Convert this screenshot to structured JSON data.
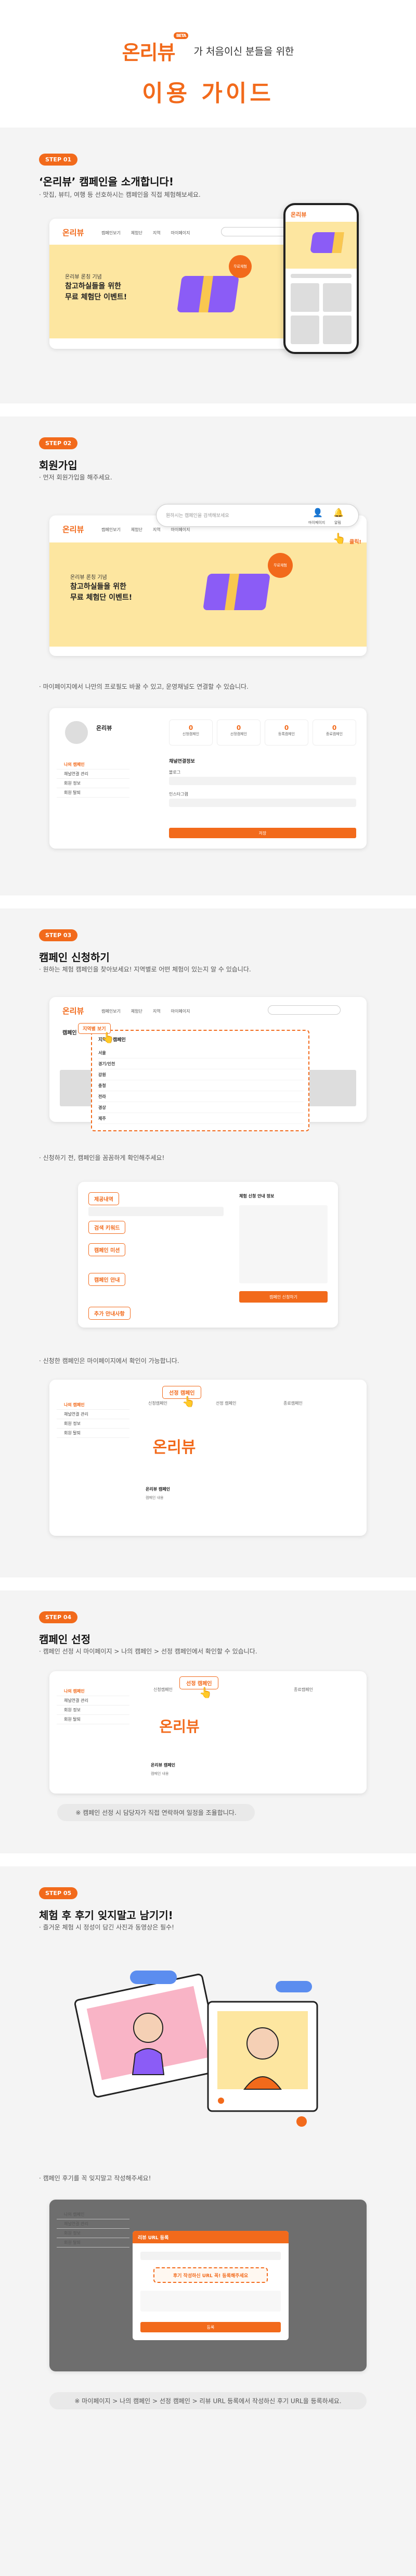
{
  "hero": {
    "logo": "온리뷰",
    "beta": "BETA",
    "subtitle": "가 처음이신 분들을 위한",
    "title": "이용 가이드"
  },
  "steps": [
    {
      "badge": "STEP 01",
      "title": "‘온리뷰’ 캠페인을 소개합니다!",
      "desc": "· 맛집, 뷰티, 여행 등 선호하시는 캠페인을 직접 체험해보세요."
    },
    {
      "badge": "STEP 02",
      "title": "회원가입",
      "desc": "· 먼저 회원가입을 해주세요.",
      "desc2": "· 마이페이지에서 나만의 프로필도 바꿀 수 있고, 운영채널도 연결할 수 있습니다."
    },
    {
      "badge": "STEP 03",
      "title": "캠페인 신청하기",
      "desc": "· 원하는 체험 캠페인을 찾아보세요! 지역별로 어떤 체험이 있는지 알 수 있습니다.",
      "desc2": "· 신청하기 전, 캠페인을 꼼꼼하게 확인해주세요!",
      "desc3": "· 신청한 캠페인은 마이페이지에서 확인이 가능합니다."
    },
    {
      "badge": "STEP 04",
      "title": "캠페인 선정",
      "desc": "· 캠페인 선정 시 마이페이지 > 나의 캠페인 > 선정 캠페인에서 확인할 수 있습니다.",
      "note": "※ 캠페인 선정 시 담당자가 직접 연락하여 일정을 조율합니다."
    },
    {
      "badge": "STEP 05",
      "title": "체험 후 후기 잊지말고 남기기!",
      "desc": "· 즐거운 체험 시 정성이 담긴 사진과 동영상은 필수!",
      "desc2": "· 캠페인 후기를 꼭 잊지말고 작성해주세요!",
      "note": "※ 마이페이지 > 나의 캠페인 > 선정 캠페인 > 리뷰 URL 등록에서 작성하신 후기 URL을 등록하세요."
    }
  ],
  "mock1": {
    "nav": [
      "캠페인보기",
      "체험단",
      "지역",
      "마이페이지"
    ],
    "banner_small": "온리뷰 론칭 기념",
    "banner_big1": "참고하실들을 위한",
    "banner_big2": "무료 체험단 이벤트!",
    "bubble": "무료체험"
  },
  "mock2": {
    "search_placeholder": "원하시는 캠페인을 검색해보세요",
    "icon_labels": [
      "마이페이지",
      "알림"
    ],
    "click_label": "클릭!"
  },
  "mypage": {
    "name": "온리뷰",
    "menu": [
      "나의 캠페인",
      "채널연결 관리",
      "회원 정보",
      "회원 탈퇴"
    ],
    "stats": [
      "신청캠페인",
      "선정캠페인",
      "등록캠페인",
      "종료캠페인"
    ],
    "stat_values": [
      "0",
      "0",
      "0",
      "0"
    ],
    "section_title": "채널연결정보",
    "fields": [
      "블로그",
      "인스타그램"
    ],
    "save": "저장"
  },
  "mock3": {
    "menu_title": "지역별 보기",
    "regions": [
      "서울",
      "경기/인천",
      "강원",
      "충청",
      "전라",
      "경상",
      "제주"
    ],
    "dropdown_head": "지역별 캠페인",
    "tab": "캠페인"
  },
  "detail": {
    "tags": [
      "제공내역",
      "검색 키워드",
      "캠페인 미션",
      "캠페인 안내",
      "추가 안내사항"
    ],
    "apply": "캠페인 신청하기",
    "right_title": "체험 신청 안내 정보"
  },
  "applied": {
    "tab_selected": "선정 캠페인",
    "tabs": [
      "신청캠페인",
      "선정 캠페인",
      "종료캠페인"
    ],
    "campaign_name": "온리뷰 캠페인",
    "campaign_sub": "캠페인 내용",
    "menu": [
      "나의 캠페인",
      "채널연결 관리",
      "회원 정보",
      "회원 탈퇴"
    ]
  },
  "review": {
    "modal_title": "리뷰 URL 등록",
    "tip": "후기 작성하신 URL 꼭! 등록해주세요",
    "btn": "등록",
    "menu": [
      "나의 캠페인",
      "채널연결 관리",
      "회원 정보",
      "회원 탈퇴"
    ]
  },
  "colors": {
    "brand": "#f26a1b",
    "bg": "#f4f4f4",
    "banner": "#fde6a0",
    "purple": "#8b5cf6"
  }
}
